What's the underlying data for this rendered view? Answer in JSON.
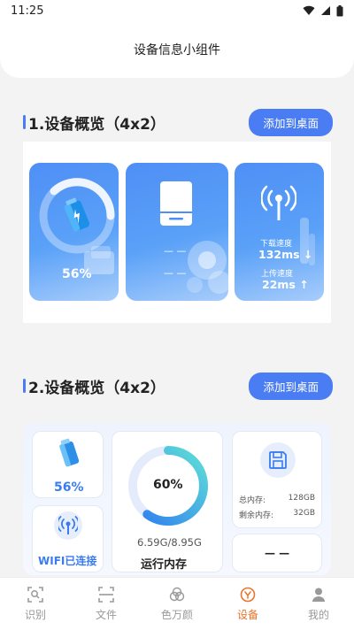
{
  "status_bar": {
    "time": "11:25"
  },
  "header": {
    "title": "设备信息小组件"
  },
  "section1": {
    "title": "1.设备概览（4x2）",
    "add_button": "添加到桌面",
    "battery_percent": "56%",
    "storage_dashes": [
      "— —",
      "— —"
    ],
    "network": {
      "download_label": "下载速度",
      "download_value": "132ms",
      "download_arrow": "↓",
      "upload_label": "上传速度",
      "upload_value": "22ms",
      "upload_arrow": "↑"
    }
  },
  "section2": {
    "title": "2.设备概览（4x2）",
    "add_button": "添加到桌面",
    "battery_percent": "56%",
    "wifi_status": "WIFI已连接",
    "memory_percent": "60%",
    "memory_fraction": 0.6,
    "memory_usage": "6.59G/8.95G",
    "memory_label": "运行内存",
    "total_storage_label": "总内存:",
    "total_storage_value": "128GB",
    "free_storage_label": "剩余内存:",
    "free_storage_value": "32GB",
    "bottom_dashes": "— —"
  },
  "nav": {
    "items": [
      {
        "label": "识别",
        "icon": "scan-icon"
      },
      {
        "label": "文件",
        "icon": "file-scan-icon"
      },
      {
        "label": "色万颜",
        "icon": "color-circles-icon"
      },
      {
        "label": "设备",
        "icon": "device-icon"
      },
      {
        "label": "我的",
        "icon": "person-icon"
      }
    ],
    "active_index": 3
  },
  "colors": {
    "accent": "#4a7cf3",
    "nav_active": "#e8742c"
  }
}
